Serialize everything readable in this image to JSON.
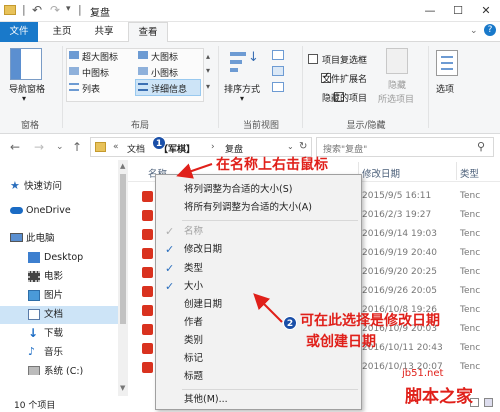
{
  "title": "复盘",
  "tabs": [
    "文件",
    "主页",
    "共享",
    "查看"
  ],
  "ribbon": {
    "nav_pane": "导航窗格",
    "layout_items": [
      "超大图标",
      "大图标",
      "中图标",
      "小图标",
      "列表",
      "详细信息"
    ],
    "sort": "排序方式",
    "show_hide": {
      "item_checkbox": "项目复选框",
      "file_ext": "文件扩展名",
      "hidden_items": "隐藏的项目",
      "hide_selected": "隐藏",
      "hide_selected2": "所选项目",
      "options": "选项"
    },
    "groups": [
      "窗格",
      "布局",
      "当前视图",
      "显示/隐藏"
    ]
  },
  "address": {
    "path": [
      "«",
      "文档",
      "【军棋】",
      "›",
      "复盘"
    ],
    "search_placeholder": "搜索\"复盘\""
  },
  "nav": [
    {
      "label": "快速访问",
      "icon": "star-icon"
    },
    {
      "label": "OneDrive",
      "icon": "cloud-icon"
    },
    {
      "label": "此电脑",
      "icon": "computer-icon"
    },
    {
      "label": "Desktop",
      "icon": "desktop-folder-icon"
    },
    {
      "label": "电影",
      "icon": "movie-icon"
    },
    {
      "label": "图片",
      "icon": "picture-icon"
    },
    {
      "label": "文档",
      "icon": "documents-icon"
    },
    {
      "label": "下载",
      "icon": "download-icon"
    },
    {
      "label": "音乐",
      "icon": "music-icon"
    },
    {
      "label": "系统 (C:)",
      "icon": "drive-icon"
    }
  ],
  "columns": {
    "name": "名称",
    "modified": "修改日期",
    "type": "类型"
  },
  "files": [
    {
      "date": "2015/9/5 16:11",
      "type": "Tenc"
    },
    {
      "date": "2016/2/3 19:27",
      "type": "Tenc"
    },
    {
      "date": "2016/9/14 19:03",
      "type": "Tenc"
    },
    {
      "date": "2016/9/19 20:40",
      "type": "Tenc"
    },
    {
      "date": "2016/9/20 20:25",
      "type": "Tenc"
    },
    {
      "date": "2016/9/26 20:05",
      "type": "Tenc"
    },
    {
      "date": "2016/10/8 19:26",
      "type": "Tenc"
    },
    {
      "date": "2016/10/9 20:03",
      "type": "Tenc"
    },
    {
      "date": "2016/10/11 20:43",
      "type": "Tenc"
    },
    {
      "date": "2016/10/13 20:07",
      "type": "Tenc"
    }
  ],
  "status": "10 个项目",
  "context_menu": {
    "fit_col": "将列调整为合适的大小(S)",
    "fit_all": "将所有列调整为合适的大小(A)",
    "items": [
      {
        "label": "名称",
        "checked": true,
        "disabled": true
      },
      {
        "label": "修改日期",
        "checked": true
      },
      {
        "label": "类型",
        "checked": true
      },
      {
        "label": "大小",
        "checked": true
      },
      {
        "label": "创建日期",
        "checked": false
      },
      {
        "label": "作者",
        "checked": false
      },
      {
        "label": "类别",
        "checked": false
      },
      {
        "label": "标记",
        "checked": false
      },
      {
        "label": "标题",
        "checked": false
      }
    ],
    "more": "其他(M)..."
  },
  "annotations": {
    "step1_num": "1",
    "step1_text": "在名称上右击鼠标",
    "step2_num": "2",
    "step2_text_line1": "可在此选择是修改日期",
    "step2_text_line2": "或创建日期"
  },
  "watermark": {
    "line1": "jb51.net",
    "line2": "脚本之家"
  },
  "colors": {
    "accent": "#1979ca",
    "annotation": "#e0201a",
    "badge": "#1a4fa8"
  }
}
